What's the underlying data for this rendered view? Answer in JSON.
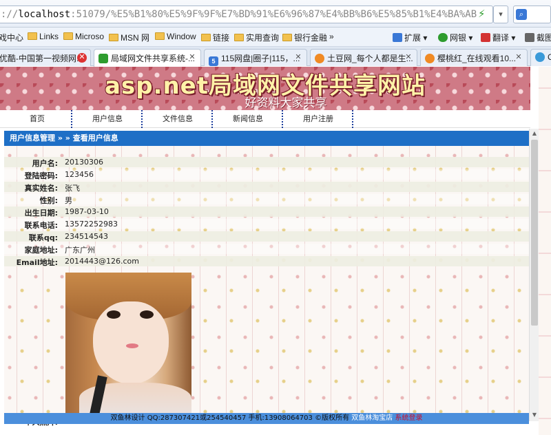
{
  "browser": {
    "address_prefix": "://",
    "address_host": "localhost",
    "address_rest": ":51079/%E5%B1%80%E5%9F%9F%E7%BD%91%E6%96%87%E4%BB%B6%E5%85%B1%E4%BA%AB",
    "go_icon": "lightning-icon",
    "dropdown_glyph": "▾"
  },
  "favorites": {
    "items": [
      {
        "label": "戏中心",
        "icon": "none"
      },
      {
        "label": "Links",
        "icon": "folder-icon"
      },
      {
        "label": "Microso",
        "icon": "folder-icon"
      },
      {
        "label": "MSN 网",
        "icon": "folder-icon"
      },
      {
        "label": "Window",
        "icon": "folder-icon"
      },
      {
        "label": "链接",
        "icon": "folder-icon"
      },
      {
        "label": "实用查询",
        "icon": "folder-icon"
      },
      {
        "label": "银行金融",
        "icon": "folder-icon"
      }
    ],
    "more": "»",
    "tools": [
      {
        "label": "扩展",
        "color": "#3a78d6"
      },
      {
        "label": "网银",
        "color": "#2e9c2e"
      },
      {
        "label": "翻译",
        "color": "#d33333"
      },
      {
        "label": "截图",
        "color": "#666666"
      }
    ]
  },
  "tabs": [
    {
      "label": "优酷-中国第一视频网...",
      "icon_text": "",
      "icon_color": "#e8743b",
      "close": "✕",
      "active": false
    },
    {
      "label": "局域网文件共享系统-...",
      "icon_text": "",
      "icon_color": "#2e9c2e",
      "close": "✕",
      "active": true
    },
    {
      "label": "115网盘|圈子|115，...",
      "icon_text": "5",
      "icon_color": "#3a78d6",
      "close": "✕",
      "active": false
    },
    {
      "label": "土豆网_每个人都是生...",
      "icon_text": "",
      "icon_color": "#f08a24",
      "close": "✕",
      "active": false
    },
    {
      "label": "樱桃红_在线观看10...",
      "icon_text": "",
      "icon_color": "#f08a24",
      "close": "✕",
      "active": false
    },
    {
      "label": "C",
      "icon_text": "",
      "icon_color": "#3a9ad9",
      "close": "",
      "active": false
    }
  ],
  "site": {
    "title": "asp.net局域网文件共享网站",
    "subtitle": "好资料大家共享",
    "nav": [
      "首页",
      "用户信息",
      "文件信息",
      "新闻信息",
      "用户注册"
    ],
    "breadcrumb": "用户信息管理 » » 查看用户信息",
    "fields": [
      {
        "label": "用户名:",
        "value": "20130306"
      },
      {
        "label": "登陆密码:",
        "value": "123456"
      },
      {
        "label": "真实姓名:",
        "value": "张飞"
      },
      {
        "label": "性别:",
        "value": "男"
      },
      {
        "label": "出生日期:",
        "value": "1987-03-10"
      },
      {
        "label": "联系电话:",
        "value": "13572252983"
      },
      {
        "label": "联系qq:",
        "value": "234514543"
      },
      {
        "label": "家庭地址:",
        "value": "广东广州"
      },
      {
        "label": "Email地址:",
        "value": "2014443@126.com"
      }
    ],
    "photo_label": "个人照片:",
    "footer": {
      "text": "双鱼林设计 QQ:287307421或254540457 手机:13908064703 ©版权所有",
      "link": "双鱼林淘宝店",
      "login": "系统登录"
    }
  }
}
